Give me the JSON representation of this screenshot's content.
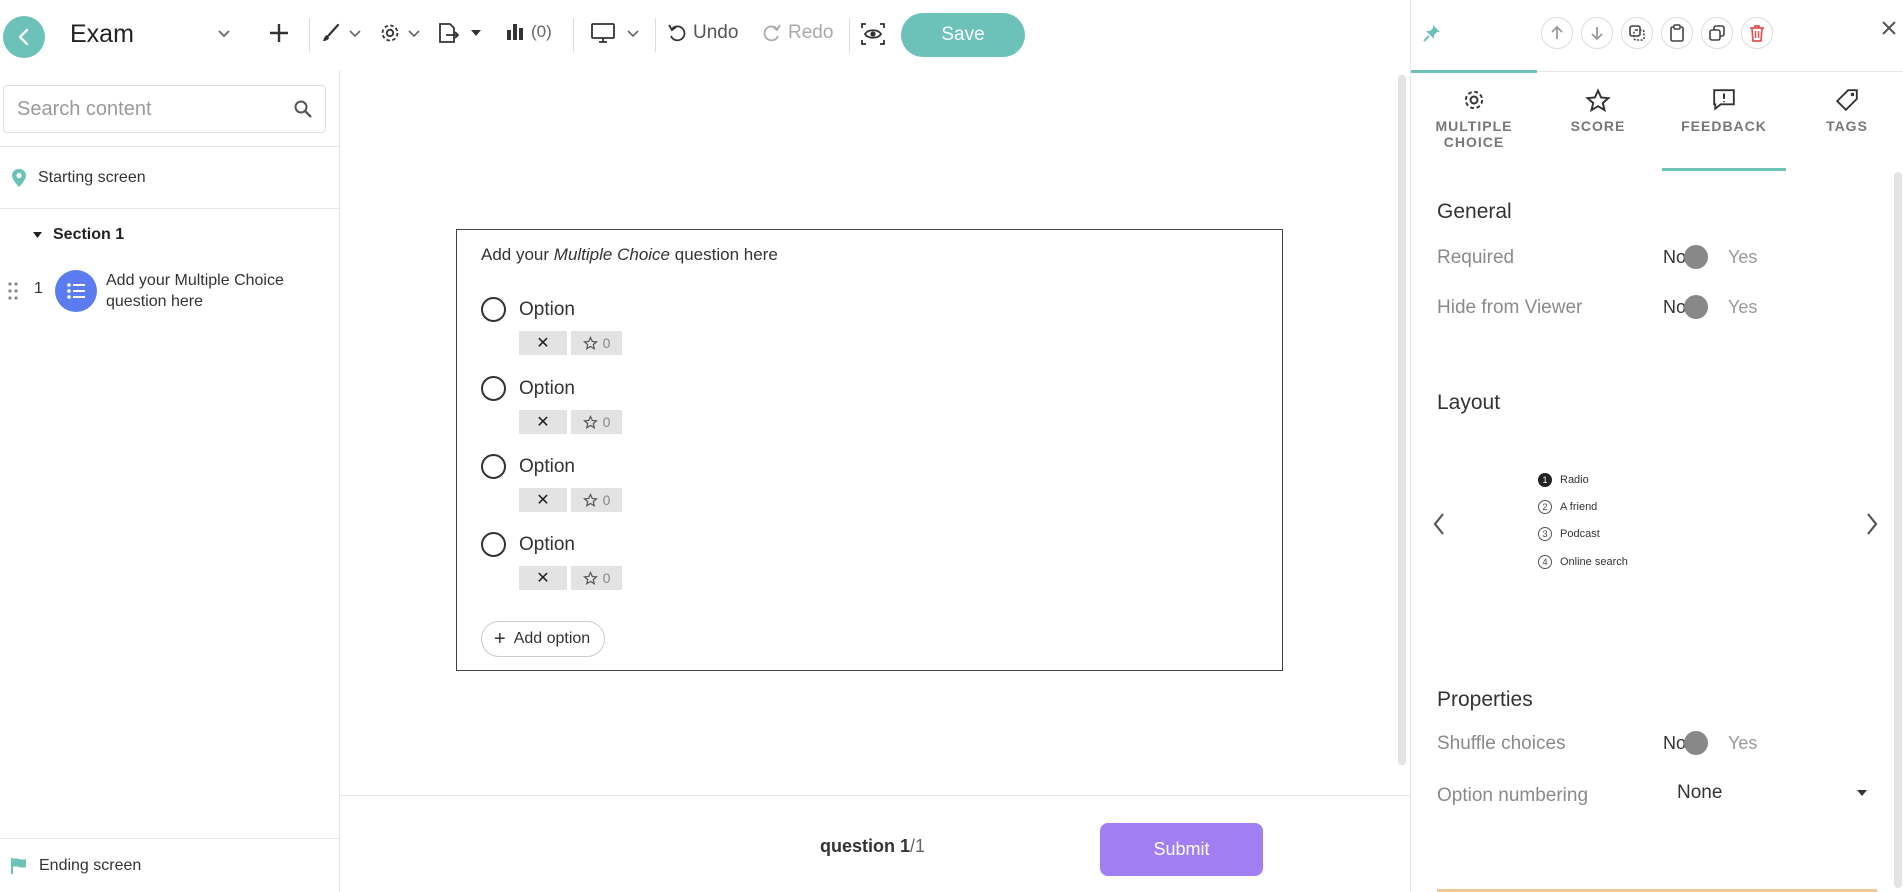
{
  "toolbar": {
    "title": "Exam",
    "stats_count": "(0)",
    "undo_label": "Undo",
    "redo_label": "Redo",
    "save_label": "Save"
  },
  "sidebar": {
    "search_placeholder": "Search content",
    "starting_screen": "Starting screen",
    "section_label": "Section 1",
    "question_number": "1",
    "question_text": "Add your Multiple Choice question here",
    "ending_screen": "Ending screen"
  },
  "question": {
    "title_prefix": "Add your",
    "title_emphasis": "Multiple Choice",
    "title_suffix": "question here",
    "options": [
      {
        "label": "Option",
        "score": "0"
      },
      {
        "label": "Option",
        "score": "0"
      },
      {
        "label": "Option",
        "score": "0"
      },
      {
        "label": "Option",
        "score": "0"
      }
    ],
    "add_option_label": "Add option"
  },
  "footer": {
    "pager_word": "question",
    "pager_current": "1",
    "pager_total": "/1",
    "submit_label": "Submit"
  },
  "panel": {
    "tabs": [
      {
        "label_line1": "MULTIPLE",
        "label_line2": "CHOICE",
        "icon": "gear-icon"
      },
      {
        "label_line1": "SCORE",
        "label_line2": "",
        "icon": "star-icon"
      },
      {
        "label_line1": "FEEDBACK",
        "label_line2": "",
        "icon": "feedback-icon"
      },
      {
        "label_line1": "TAGS",
        "label_line2": "",
        "icon": "tag-icon"
      }
    ],
    "active_tab": "FEEDBACK",
    "general_title": "General",
    "required_label": "Required",
    "hide_label": "Hide from Viewer",
    "no_label": "No",
    "yes_label": "Yes",
    "layout_title": "Layout",
    "layout_preview": [
      "Radio",
      "A friend",
      "Podcast",
      "Online search"
    ],
    "layout_preview_numbers": [
      "1",
      "2",
      "3",
      "4"
    ],
    "properties_title": "Properties",
    "shuffle_label": "Shuffle choices",
    "numbering_label": "Option numbering",
    "numbering_value": "None"
  },
  "colors": {
    "accent_teal": "#6cc2b8",
    "question_badge": "#5b7cf0",
    "submit_purple": "#a17ef1",
    "delete_red": "#e05555"
  }
}
